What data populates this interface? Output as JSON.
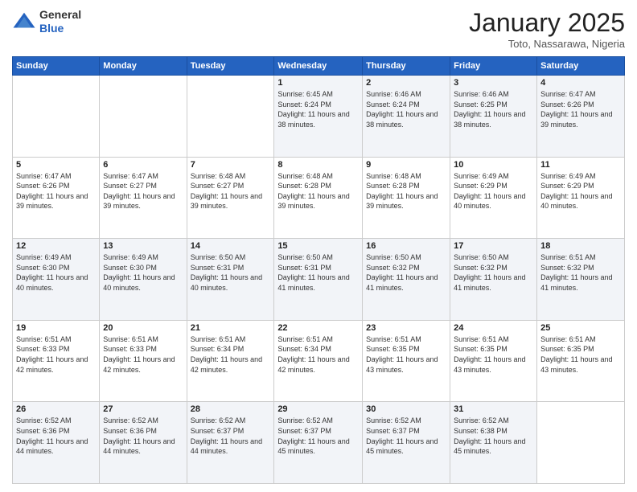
{
  "logo": {
    "general": "General",
    "blue": "Blue"
  },
  "header": {
    "month": "January 2025",
    "location": "Toto, Nassarawa, Nigeria"
  },
  "days_of_week": [
    "Sunday",
    "Monday",
    "Tuesday",
    "Wednesday",
    "Thursday",
    "Friday",
    "Saturday"
  ],
  "weeks": [
    [
      {
        "day": "",
        "info": ""
      },
      {
        "day": "",
        "info": ""
      },
      {
        "day": "",
        "info": ""
      },
      {
        "day": "1",
        "info": "Sunrise: 6:45 AM\nSunset: 6:24 PM\nDaylight: 11 hours and 38 minutes."
      },
      {
        "day": "2",
        "info": "Sunrise: 6:46 AM\nSunset: 6:24 PM\nDaylight: 11 hours and 38 minutes."
      },
      {
        "day": "3",
        "info": "Sunrise: 6:46 AM\nSunset: 6:25 PM\nDaylight: 11 hours and 38 minutes."
      },
      {
        "day": "4",
        "info": "Sunrise: 6:47 AM\nSunset: 6:26 PM\nDaylight: 11 hours and 39 minutes."
      }
    ],
    [
      {
        "day": "5",
        "info": "Sunrise: 6:47 AM\nSunset: 6:26 PM\nDaylight: 11 hours and 39 minutes."
      },
      {
        "day": "6",
        "info": "Sunrise: 6:47 AM\nSunset: 6:27 PM\nDaylight: 11 hours and 39 minutes."
      },
      {
        "day": "7",
        "info": "Sunrise: 6:48 AM\nSunset: 6:27 PM\nDaylight: 11 hours and 39 minutes."
      },
      {
        "day": "8",
        "info": "Sunrise: 6:48 AM\nSunset: 6:28 PM\nDaylight: 11 hours and 39 minutes."
      },
      {
        "day": "9",
        "info": "Sunrise: 6:48 AM\nSunset: 6:28 PM\nDaylight: 11 hours and 39 minutes."
      },
      {
        "day": "10",
        "info": "Sunrise: 6:49 AM\nSunset: 6:29 PM\nDaylight: 11 hours and 40 minutes."
      },
      {
        "day": "11",
        "info": "Sunrise: 6:49 AM\nSunset: 6:29 PM\nDaylight: 11 hours and 40 minutes."
      }
    ],
    [
      {
        "day": "12",
        "info": "Sunrise: 6:49 AM\nSunset: 6:30 PM\nDaylight: 11 hours and 40 minutes."
      },
      {
        "day": "13",
        "info": "Sunrise: 6:49 AM\nSunset: 6:30 PM\nDaylight: 11 hours and 40 minutes."
      },
      {
        "day": "14",
        "info": "Sunrise: 6:50 AM\nSunset: 6:31 PM\nDaylight: 11 hours and 40 minutes."
      },
      {
        "day": "15",
        "info": "Sunrise: 6:50 AM\nSunset: 6:31 PM\nDaylight: 11 hours and 41 minutes."
      },
      {
        "day": "16",
        "info": "Sunrise: 6:50 AM\nSunset: 6:32 PM\nDaylight: 11 hours and 41 minutes."
      },
      {
        "day": "17",
        "info": "Sunrise: 6:50 AM\nSunset: 6:32 PM\nDaylight: 11 hours and 41 minutes."
      },
      {
        "day": "18",
        "info": "Sunrise: 6:51 AM\nSunset: 6:32 PM\nDaylight: 11 hours and 41 minutes."
      }
    ],
    [
      {
        "day": "19",
        "info": "Sunrise: 6:51 AM\nSunset: 6:33 PM\nDaylight: 11 hours and 42 minutes."
      },
      {
        "day": "20",
        "info": "Sunrise: 6:51 AM\nSunset: 6:33 PM\nDaylight: 11 hours and 42 minutes."
      },
      {
        "day": "21",
        "info": "Sunrise: 6:51 AM\nSunset: 6:34 PM\nDaylight: 11 hours and 42 minutes."
      },
      {
        "day": "22",
        "info": "Sunrise: 6:51 AM\nSunset: 6:34 PM\nDaylight: 11 hours and 42 minutes."
      },
      {
        "day": "23",
        "info": "Sunrise: 6:51 AM\nSunset: 6:35 PM\nDaylight: 11 hours and 43 minutes."
      },
      {
        "day": "24",
        "info": "Sunrise: 6:51 AM\nSunset: 6:35 PM\nDaylight: 11 hours and 43 minutes."
      },
      {
        "day": "25",
        "info": "Sunrise: 6:51 AM\nSunset: 6:35 PM\nDaylight: 11 hours and 43 minutes."
      }
    ],
    [
      {
        "day": "26",
        "info": "Sunrise: 6:52 AM\nSunset: 6:36 PM\nDaylight: 11 hours and 44 minutes."
      },
      {
        "day": "27",
        "info": "Sunrise: 6:52 AM\nSunset: 6:36 PM\nDaylight: 11 hours and 44 minutes."
      },
      {
        "day": "28",
        "info": "Sunrise: 6:52 AM\nSunset: 6:37 PM\nDaylight: 11 hours and 44 minutes."
      },
      {
        "day": "29",
        "info": "Sunrise: 6:52 AM\nSunset: 6:37 PM\nDaylight: 11 hours and 45 minutes."
      },
      {
        "day": "30",
        "info": "Sunrise: 6:52 AM\nSunset: 6:37 PM\nDaylight: 11 hours and 45 minutes."
      },
      {
        "day": "31",
        "info": "Sunrise: 6:52 AM\nSunset: 6:38 PM\nDaylight: 11 hours and 45 minutes."
      },
      {
        "day": "",
        "info": ""
      }
    ]
  ]
}
